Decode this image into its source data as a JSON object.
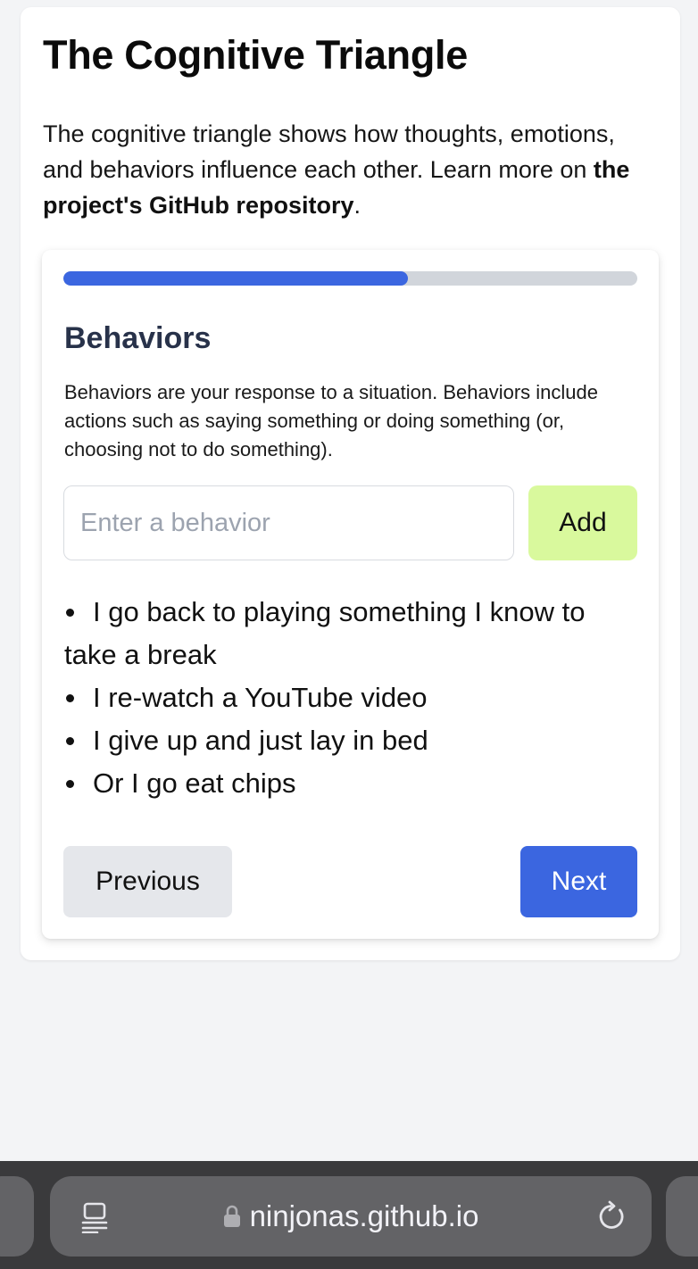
{
  "page": {
    "title": "The Cognitive Triangle",
    "intro_text": "The cognitive triangle shows how thoughts, emotions, and behaviors influence each other. Learn more on ",
    "intro_link": "the project's GitHub repository",
    "intro_end": "."
  },
  "progress": {
    "value_percent": 60
  },
  "section": {
    "heading": "Behaviors",
    "description": "Behaviors are your response to a situation. Behaviors include actions such as saying something or doing something (or, choosing not to do something)."
  },
  "input": {
    "placeholder": "Enter a behavior",
    "value": ""
  },
  "add_label": "Add",
  "behaviors": [
    "I go back to playing something I know to take a break",
    "I re-watch a YouTube video",
    "I give up and just lay in bed",
    "Or I go eat chips"
  ],
  "nav": {
    "previous_label": "Previous",
    "next_label": "Next"
  },
  "browser": {
    "url": "ninjonas.github.io",
    "icons": [
      "reader-icon",
      "lock-icon",
      "reload-icon"
    ]
  },
  "colors": {
    "accent": "#3b66e0",
    "add_button": "#d9f99d",
    "progress_track": "#d1d5db",
    "background": "#f3f4f6"
  }
}
